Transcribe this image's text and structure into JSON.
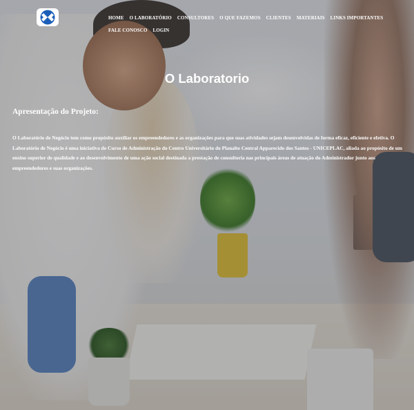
{
  "nav": {
    "items": [
      "HOME",
      "O LABORATÓRIO",
      "CONSULTORES",
      "O QUE FAZEMOS",
      "CLIENTES",
      "MATERIAIS",
      "LINKS IMPORTANTES",
      "FALE CONOSCO",
      "LOGIN"
    ]
  },
  "logo": {
    "icon": "logo-icon",
    "color": "#1c5fb8"
  },
  "page": {
    "title": "O Laboratorio",
    "section_heading": "Apresentação do Projeto:",
    "paragraph": "O Laboratório de Negócio tem como propósito auxiliar os empreendedores e as organizações para que suas atividades sejam desenvolvidas de forma eficaz, eficiente e efetiva. O Laboratório de Negócio é uma iniciativa do Curso de Administração do Centro Universitário do Planalto Central Apparecido dos Santos - UNICEPLAC, aliada ao propósito de um ensino superior de qualidade e ao desenvolvimento de uma ação social destinada a prestação de consultoria nas principais áreas de atuação do Administrador junto aos empreendedores e suas organizações."
  }
}
